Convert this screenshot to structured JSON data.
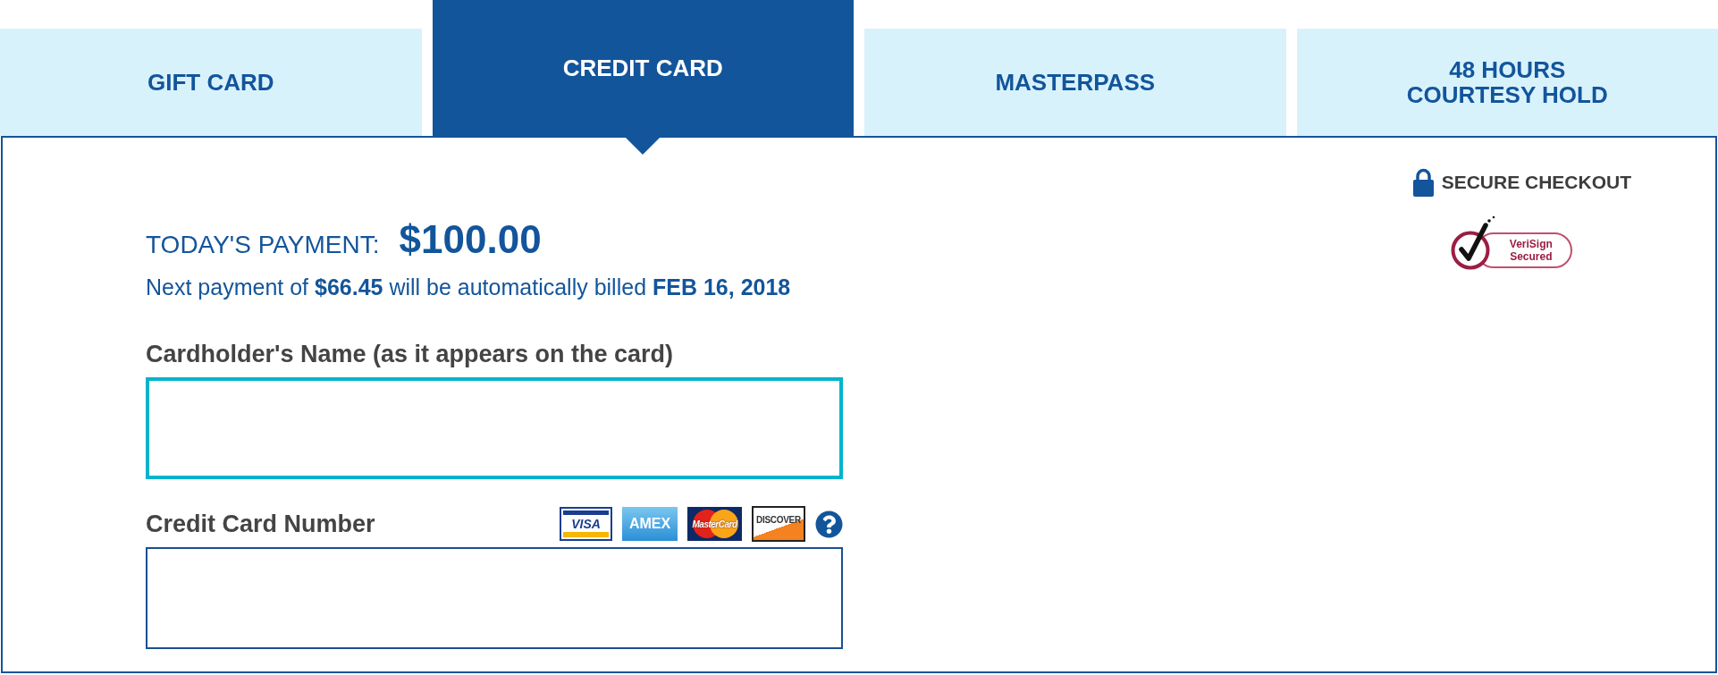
{
  "tabs": [
    {
      "label": "GIFT CARD",
      "selected": false
    },
    {
      "label": "CREDIT CARD",
      "selected": true
    },
    {
      "label": "MASTERPASS",
      "selected": false
    },
    {
      "label": "48 HOURS\nCOURTESY HOLD",
      "selected": false
    }
  ],
  "payment": {
    "label": "TODAY'S PAYMENT:",
    "amount": "$100.00",
    "note": "Next payment of **$66.45** will be automatically billed **FEB 16, 2018**"
  },
  "fields": [
    {
      "label": "Cardholder's Name (as it appears on the card)",
      "focused": true
    },
    {
      "label": "Credit Card Number",
      "focused": false,
      "card_logos": [
        {
          "kind": "visa",
          "text": "VISA"
        },
        {
          "kind": "amex",
          "text": "AMEX"
        },
        {
          "kind": "mastercard",
          "text": "MasterCard"
        },
        {
          "kind": "discover",
          "text": "DISCOVER"
        }
      ]
    }
  ],
  "secure": {
    "label": "SECURE CHECKOUT",
    "badge": "VeriSign Secured"
  }
}
